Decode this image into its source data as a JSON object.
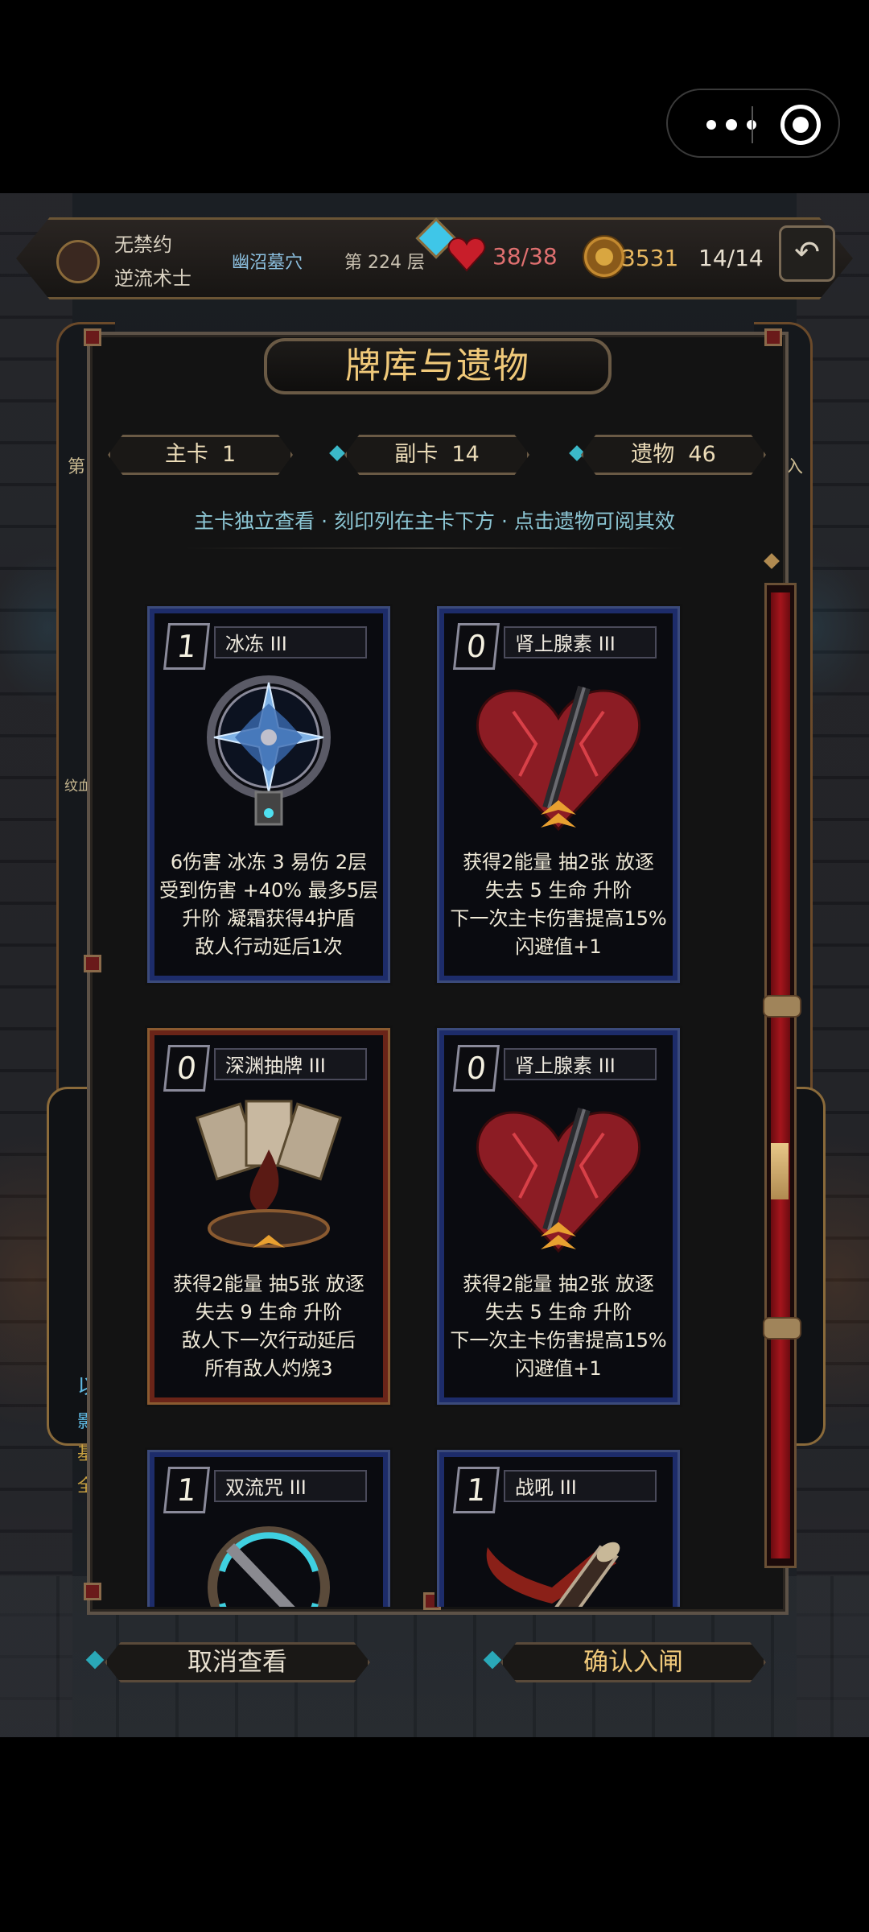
{
  "capsule": {
    "menu_icon": "more-dots-icon",
    "close_icon": "target-circle-icon"
  },
  "hud": {
    "name_line1": "无禁约",
    "name_line2": "逆流术士",
    "location": "幽沼墓穴",
    "floor": "第 224 层",
    "hp": "38/38",
    "gold": "3531",
    "energy": "14/14"
  },
  "background": {
    "left_label_top": "第",
    "right_label_top": "入",
    "left_label_mid": "纹血",
    "left_side_lines": [
      "以",
      "影",
      "基",
      "全"
    ]
  },
  "modal": {
    "title": "牌库与遗物",
    "tabs": [
      {
        "label": "主卡",
        "count": "1"
      },
      {
        "label": "副卡",
        "count": "14"
      },
      {
        "label": "遗物",
        "count": "46"
      }
    ],
    "hint": "主卡独立查看 · 刻印列在主卡下方 · 点击遗物可阅其效",
    "cards": [
      {
        "cost": "1",
        "name": "冰冻 III",
        "frame": "blue",
        "desc": [
          "6伤害 冰冻 3 易伤 2层",
          "受到伤害 +40% 最多5层",
          "升阶 凝霜获得4护盾",
          "敌人行动延后1次"
        ]
      },
      {
        "cost": "0",
        "name": "肾上腺素 III",
        "frame": "blue",
        "desc": [
          "获得2能量 抽2张 放逐",
          "失去 5 生命 升阶",
          "下一次主卡伤害提高15%",
          "闪避值+1"
        ]
      },
      {
        "cost": "0",
        "name": "深渊抽牌 III",
        "frame": "red",
        "desc": [
          "获得2能量 抽5张 放逐",
          "失去 9 生命 升阶",
          "敌人下一次行动延后",
          "所有敌人灼烧3"
        ]
      },
      {
        "cost": "0",
        "name": "肾上腺素 III",
        "frame": "blue",
        "desc": [
          "获得2能量 抽2张 放逐",
          "失去 5 生命 升阶",
          "下一次主卡伤害提高15%",
          "闪避值+1"
        ]
      },
      {
        "cost": "1",
        "name": "双流咒 III",
        "frame": "blue",
        "desc": []
      },
      {
        "cost": "1",
        "name": "战吼 III",
        "frame": "blue",
        "desc": []
      }
    ]
  },
  "buttons": {
    "cancel": "取消查看",
    "confirm": "确认入闸"
  },
  "colors": {
    "title_gold": "#f0c97a",
    "hint_cyan": "#8cc6d4",
    "blue_frame": "#1d2c6a",
    "red_frame": "#6a2418",
    "scrollbar_red": "#a4151c"
  }
}
